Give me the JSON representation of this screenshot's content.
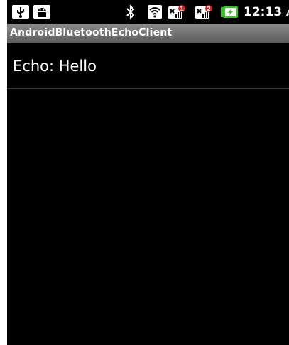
{
  "status_bar": {
    "time": "12:13",
    "ampm": "AM",
    "icons": [
      "usb-icon",
      "android-debug-icon",
      "bluetooth-icon",
      "wifi-icon",
      "signal-1-icon",
      "signal-2-icon",
      "battery-charging-icon"
    ],
    "signal_badges": [
      "1",
      "2"
    ]
  },
  "app": {
    "title": "AndroidBluetoothEchoClient"
  },
  "list": {
    "items": [
      {
        "text": "Echo: Hello"
      }
    ]
  },
  "colors": {
    "background": "#000000",
    "title_bar": "#6e6e6e",
    "text": "#ffffff",
    "badge": "#d22222",
    "battery": "#3fbf2f"
  }
}
